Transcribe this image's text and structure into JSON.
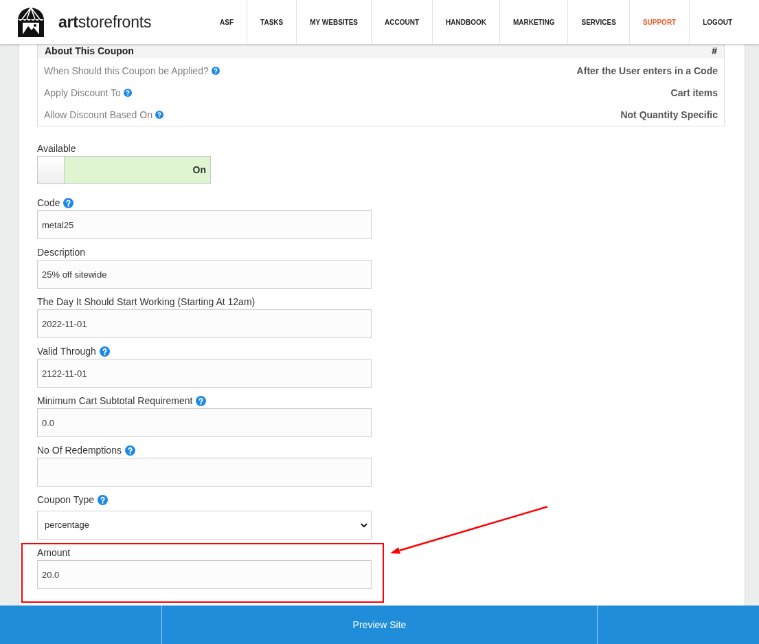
{
  "header": {
    "logo": "**art**storefronts",
    "nav": [
      {
        "label": "ASF",
        "highlighted": false
      },
      {
        "label": "TASKS",
        "highlighted": false
      },
      {
        "label": "MY WEBSITES",
        "highlighted": false
      },
      {
        "label": "ACCOUNT",
        "highlighted": false
      },
      {
        "label": "HANDBOOK",
        "highlighted": false
      },
      {
        "label": "MARKETING",
        "highlighted": false
      },
      {
        "label": "SERVICES",
        "highlighted": false
      },
      {
        "label": "SUPPORT",
        "highlighted": true
      },
      {
        "label": "LOGOUT",
        "highlighted": false
      }
    ]
  },
  "coupon_info": {
    "title": "About This Coupon",
    "column_2": "#",
    "rows": [
      {
        "label": "When Should this Coupon be Applied?",
        "help": true,
        "value": "After the User enters in a Code"
      },
      {
        "label": "Apply Discount To",
        "help": true,
        "value": "Cart items"
      },
      {
        "label": "Allow Discount Based On",
        "help": true,
        "value": "Not Quantity Specific"
      }
    ]
  },
  "available": {
    "label": "Available",
    "on": true,
    "state_text": "On"
  },
  "fields": [
    {
      "label": "Code",
      "help": true,
      "kind": "text",
      "value": "metal25",
      "annotated": false
    },
    {
      "label": "Description",
      "help": false,
      "kind": "text",
      "value": "25% off sitewide",
      "annotated": false
    },
    {
      "label": "The Day It Should Start Working (Starting At 12am)",
      "help": false,
      "kind": "text",
      "value": "2022-11-01",
      "annotated": false
    },
    {
      "label": "Valid Through",
      "help": true,
      "kind": "text",
      "value": "2122-11-01",
      "annotated": false
    },
    {
      "label": "Minimum Cart Subtotal Requirement",
      "help": true,
      "kind": "text",
      "value": "0.0",
      "annotated": false
    },
    {
      "label": "No Of Redemptions",
      "help": true,
      "kind": "text",
      "annotated": false
    },
    {
      "label": "Coupon Type",
      "help": true,
      "kind": "select",
      "value": "percentage",
      "annotated": false
    },
    {
      "label": "Amount",
      "help": false,
      "kind": "text",
      "value": "20.0",
      "annotated": true
    }
  ],
  "footer": {
    "button": "Preview Site"
  }
}
